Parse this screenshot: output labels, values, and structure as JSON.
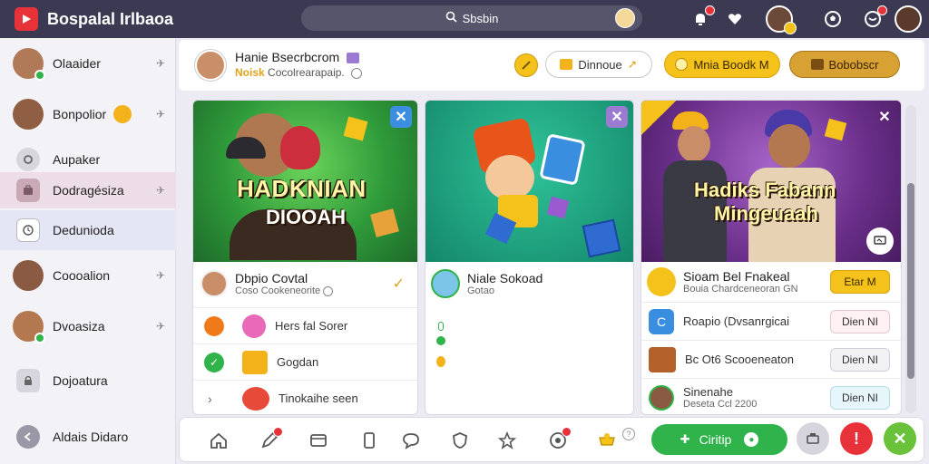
{
  "app": {
    "title": "Bospalal Irlbaoa"
  },
  "search": {
    "placeholder": "Sbsbin"
  },
  "sidebar": {
    "items": [
      {
        "label": "Olaaider"
      },
      {
        "label": "Bonpolior"
      },
      {
        "label": "Aupaker"
      },
      {
        "label": "Dodragésiza"
      },
      {
        "label": "Dedunioda"
      },
      {
        "label": "Coooalion"
      },
      {
        "label": "Dvoasiza"
      },
      {
        "label": "Dojoatura"
      },
      {
        "label": "Aldais Didaro"
      }
    ]
  },
  "header": {
    "name": "Hanie Bsecrbcrom",
    "sub_prefix": "Noisk",
    "sub_text": "Cocolrearapaip.",
    "pill_outline": "Dinnoue",
    "pill_yellow": "Mnia Boodk M",
    "pill_gold": "Bobobscr"
  },
  "cards": [
    {
      "banner_line1": "HADKNIAN",
      "banner_line2": "DIOOAH",
      "title": "Dbpio Covtal",
      "subtitle": "Coso Cookeneorite",
      "rows": [
        {
          "label": "Hers fal Sorer"
        },
        {
          "label": "Gogdan"
        },
        {
          "label": "Tinokaihe seen"
        }
      ]
    },
    {
      "title": "Niale Sokoad",
      "subtitle": "Gotao"
    },
    {
      "banner_line1": "Hadiks Fabann",
      "banner_line2": "Mingeuaah",
      "title": "Sioam Bel Fnakeal",
      "subtitle": "Bouia Chardceneoran GN",
      "btn_primary": "Etar M",
      "rows": [
        {
          "label": "Roapio (Dvsanrgicai",
          "btn": "Dien NI"
        },
        {
          "label": "Bc Ot6 Scooeneaton",
          "btn": "Dien NI"
        },
        {
          "label": "Sinenahe",
          "sub": "Deseta Ccl 2200",
          "btn": "Dien NI"
        }
      ]
    }
  ],
  "bottom": {
    "primary_label": "Ciritip"
  },
  "colors": {
    "topbar": "#3c3a52",
    "accent_red": "#e8323a",
    "accent_yellow": "#f4c21a",
    "accent_green": "#2fb34a"
  }
}
